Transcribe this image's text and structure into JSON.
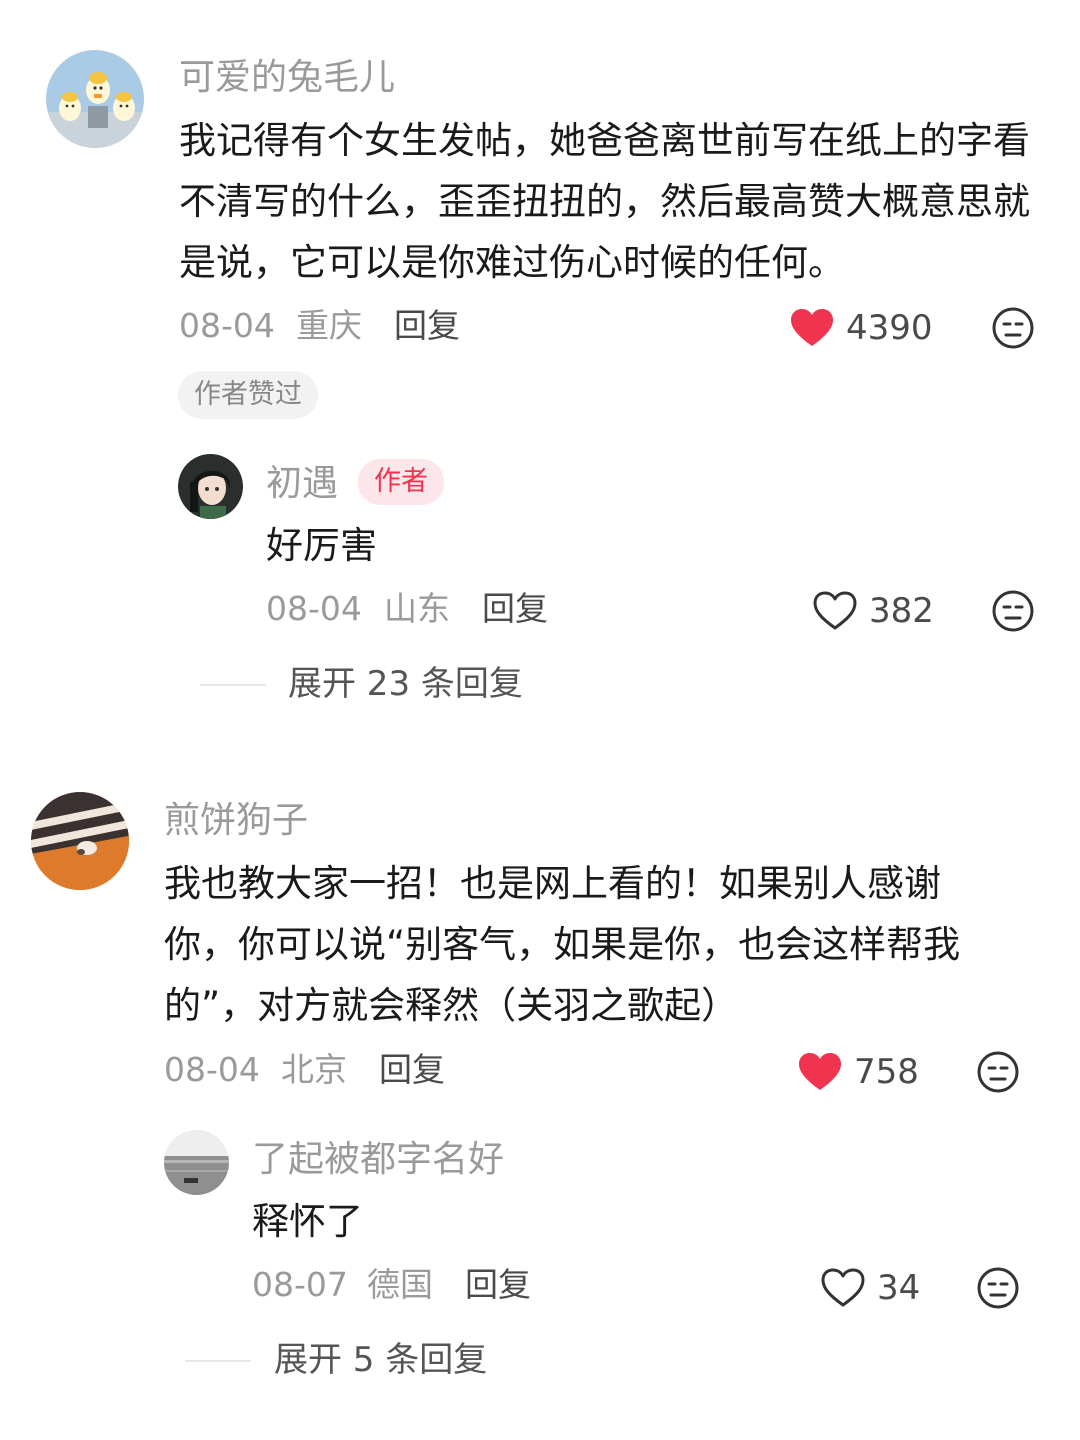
{
  "comments": [
    {
      "username": "可爱的兔毛儿",
      "text": "我记得有个女生发帖，她爸爸离世前写在纸上的字看不清写的什么，歪歪扭扭的，然后最高赞大概意思就是说，它可以是你难过伤心时候的任何。",
      "date": "08-04",
      "location": "重庆",
      "reply_label": "回复",
      "likes": "4390",
      "liked": true,
      "author_liked_tag": "作者赞过",
      "avatar": "ducks-avatar",
      "replies": [
        {
          "username": "初遇",
          "badge": "作者",
          "text": "好厉害",
          "date": "08-04",
          "location": "山东",
          "reply_label": "回复",
          "likes": "382",
          "liked": false,
          "avatar": "anime-girl-avatar"
        }
      ],
      "expand_label": "展开 23 条回复"
    },
    {
      "username": "煎饼狗子",
      "text": "我也教大家一招！也是网上看的！如果别人感谢你，你可以说“别客气，如果是你，也会这样帮我的”，对方就会释然（关羽之歌起）",
      "date": "08-04",
      "location": "北京",
      "reply_label": "回复",
      "likes": "758",
      "liked": true,
      "avatar": "striped-rug-avatar",
      "replies": [
        {
          "username": "了起被都字名好",
          "text": "释怀了",
          "date": "08-07",
          "location": "德国",
          "reply_label": "回复",
          "likes": "34",
          "liked": false,
          "avatar": "sea-avatar"
        }
      ],
      "expand_label": "展开 5 条回复"
    }
  ],
  "colors": {
    "like_red": "#f0334e",
    "meta_gray": "#9a9a9a",
    "badge_bg": "#fde6ea"
  }
}
